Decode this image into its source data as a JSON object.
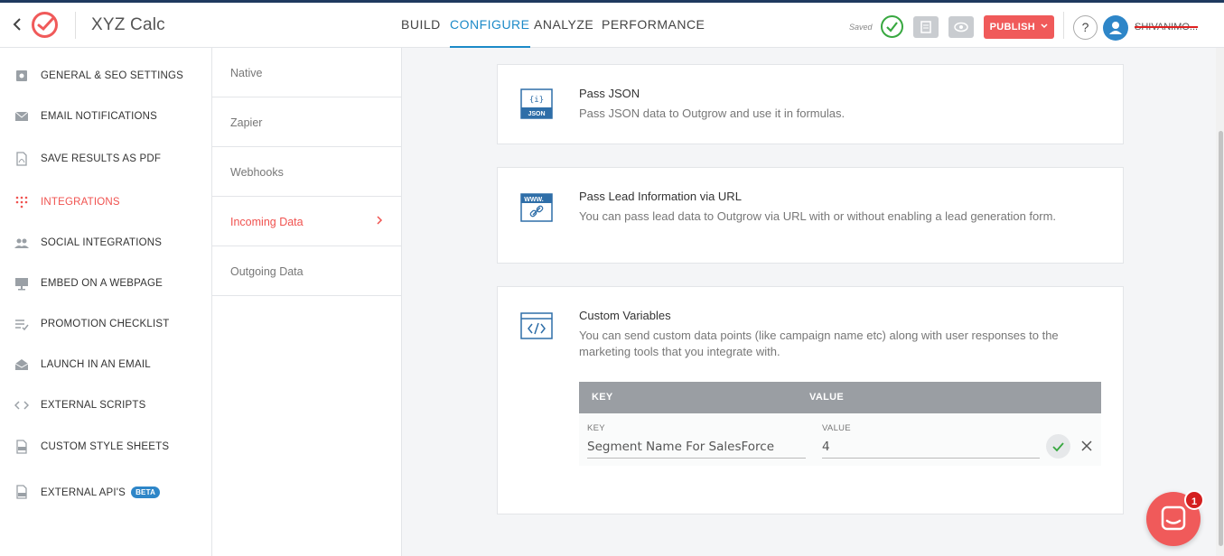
{
  "header": {
    "app_title": "XYZ Calc",
    "nav": [
      "BUILD",
      "CONFIGURE",
      "ANALYZE",
      "PERFORMANCE"
    ],
    "active_nav": "CONFIGURE",
    "saved_label": "Saved",
    "publish_label": "PUBLISH",
    "help_label": "?",
    "username": "SHIVANIMO..."
  },
  "sidebar": {
    "items": [
      {
        "label": "GENERAL & SEO SETTINGS",
        "icon": "settings-icon"
      },
      {
        "label": "EMAIL NOTIFICATIONS",
        "icon": "envelope-icon"
      },
      {
        "label": "SAVE RESULTS AS PDF",
        "icon": "pdf-icon"
      },
      {
        "label": "INTEGRATIONS",
        "icon": "integrations-icon"
      },
      {
        "label": "SOCIAL INTEGRATIONS",
        "icon": "users-icon"
      },
      {
        "label": "EMBED ON A WEBPAGE",
        "icon": "monitor-icon"
      },
      {
        "label": "PROMOTION CHECKLIST",
        "icon": "checklist-icon"
      },
      {
        "label": "LAUNCH IN AN EMAIL",
        "icon": "open-mail-icon"
      },
      {
        "label": "EXTERNAL SCRIPTS",
        "icon": "code-icon"
      },
      {
        "label": "CUSTOM STYLE SHEETS",
        "icon": "css-file-icon"
      },
      {
        "label": "EXTERNAL API'S",
        "icon": "api-file-icon",
        "badge": "BETA"
      }
    ],
    "active": "INTEGRATIONS"
  },
  "subnav": {
    "items": [
      "Native",
      "Zapier",
      "Webhooks",
      "Incoming Data",
      "Outgoing Data"
    ],
    "active": "Incoming Data"
  },
  "cards": [
    {
      "title": "Pass JSON",
      "description": "Pass JSON data to Outgrow and use it in formulas.",
      "icon": "json-icon",
      "icon_text": "JSON"
    },
    {
      "title": "Pass Lead Information via URL",
      "description": "You can pass lead data to Outgrow via URL with or without enabling a lead generation form.",
      "icon": "www-link-icon",
      "icon_text": "WWW."
    },
    {
      "title": "Custom Variables",
      "description": "You can send custom data points (like campaign name etc) along with user responses to the marketing tools that you integrate with.",
      "icon": "code-window-icon"
    }
  ],
  "custom_variables": {
    "header_key": "KEY",
    "header_value": "VALUE",
    "row": {
      "key_label": "KEY",
      "value_label": "VALUE",
      "key_value": "Segment Name For SalesForce",
      "value_value": "4"
    }
  },
  "chat": {
    "badge_count": "1"
  },
  "colors": {
    "accent_blue": "#1c8ac8",
    "accent_red": "#f05a5a",
    "saved_green": "#38a840"
  }
}
